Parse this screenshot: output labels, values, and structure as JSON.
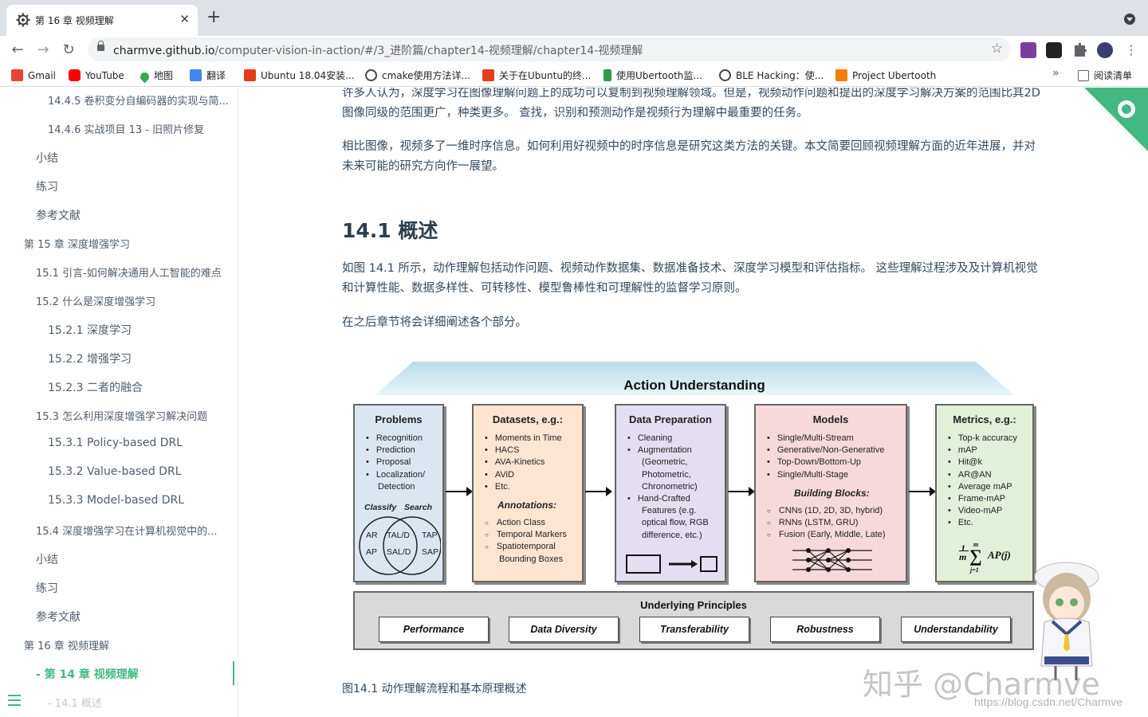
{
  "browser": {
    "tab_title": "第 16 章 视频理解",
    "tab_close": "✕",
    "new_tab": "+",
    "url_host": "charmve.github.io",
    "url_path": "/computer-vision-in-action/#/3_进阶篇/chapter14-视频理解/chapter14-视频理解",
    "back": "←",
    "forward": "→",
    "reload": "↻",
    "star": "☆",
    "bookmarks": [
      {
        "label": "Gmail",
        "icon": "gmail-icon",
        "color": "#ea4335"
      },
      {
        "label": "YouTube",
        "icon": "youtube-icon",
        "color": "#ff0000"
      },
      {
        "label": "地图",
        "icon": "maps-icon",
        "color": "#34a853"
      },
      {
        "label": "翻译",
        "icon": "translate-icon",
        "color": "#4285f4"
      },
      {
        "label": "Ubuntu 18.04安装...",
        "icon": "csdn-icon",
        "color": "#e33e1b"
      },
      {
        "label": "cmake使用方法详...",
        "icon": "zhihu-icon",
        "color": "#444444"
      },
      {
        "label": "关于在Ubuntu的终...",
        "icon": "csdn-icon",
        "color": "#e33e1b"
      },
      {
        "label": "使用Ubertooth监...",
        "icon": "bar-icon",
        "color": "#2e9b47"
      },
      {
        "label": "BLE Hacking：使...",
        "icon": "zhihu-icon",
        "color": "#444444"
      },
      {
        "label": "Project Ubertooth",
        "icon": "blogger-icon",
        "color": "#f57d00"
      }
    ],
    "more": "»",
    "reading_list": "阅读清单"
  },
  "sidebar": {
    "items": [
      {
        "label": "14.4.5 卷积变分自编码器的实现与简...",
        "level": 2,
        "small": true
      },
      {
        "label": "14.4.6 实战项目 13 - 旧照片修复",
        "level": 2,
        "small": true
      },
      {
        "label": "小结",
        "level": 1
      },
      {
        "label": "练习",
        "level": 1
      },
      {
        "label": "参考文献",
        "level": 1
      },
      {
        "label": "第 15 章 深度增强学习",
        "level": 0,
        "small": true
      },
      {
        "label": "15.1 引言-如何解决通用人工智能的难点",
        "level": 1,
        "small": true
      },
      {
        "label": "15.2 什么是深度增强学习",
        "level": 1,
        "small": true
      },
      {
        "label": "15.2.1 深度学习",
        "level": 2
      },
      {
        "label": "15.2.2 增强学习",
        "level": 2
      },
      {
        "label": "15.2.3 二者的融合",
        "level": 2
      },
      {
        "label": "15.3 怎么利用深度增强学习解决问题",
        "level": 1,
        "small": true
      },
      {
        "label": "15.3.1 Policy-based DRL",
        "level": 2
      },
      {
        "label": "15.3.2 Value-based DRL",
        "level": 2
      },
      {
        "label": "15.3.3 Model-based DRL",
        "level": 2
      },
      {
        "label": "15.4 深度增强学习在计算机视觉中的...",
        "level": 1,
        "small": true
      },
      {
        "label": "小结",
        "level": 1
      },
      {
        "label": "练习",
        "level": 1
      },
      {
        "label": "参考文献",
        "level": 1
      },
      {
        "label": "第 16 章 视频理解",
        "level": 0,
        "small": true
      },
      {
        "label": "- 第 14 章 视频理解",
        "level": 1,
        "active": true
      },
      {
        "label": "- 14.1 概述",
        "level": 2,
        "faded": true
      }
    ]
  },
  "content": {
    "intro_p1": "许多人认为，深度学习在图像理解问题上的成功可以复制到视频理解领域。但是，视频动作问题和提出的深度学习解决方案的范围比其2D图像同级的范围更广，种类更多。 查找，识别和预测动作是视频行为理解中最重要的任务。",
    "intro_p2": "相比图像，视频多了一维时序信息。如何利用好视频中的时序信息是研究这类方法的关键。本文简要回顾视频理解方面的近年进展，并对未来可能的研究方向作一展望。",
    "section_title": "14.1 概述",
    "overview_p1": "如图 14.1 所示，动作理解包括动作问题、视频动作数据集、数据准备技术、深度学习模型和评估指标。 这些理解过程涉及及计算机视觉和计算性能、数据多样性、可转移性、模型鲁棒性和可理解性的监督学习原则。",
    "overview_p2": "在之后章节将会详细阐述各个部分。",
    "caption": "图14.1 动作理解流程和基本原理概述"
  },
  "figure": {
    "title": "Action Understanding",
    "problems": {
      "title": "Problems",
      "items": [
        "Recognition",
        "Prediction",
        "Proposal",
        "Localization/",
        "Detection"
      ],
      "venn_left": "Classify",
      "venn_right": "Search",
      "venn_labels": [
        "AR",
        "AP",
        "TAL/D",
        "SAL/D",
        "TAP",
        "SAP"
      ]
    },
    "datasets": {
      "title": "Datasets, e.g.:",
      "items": [
        "Moments in Time",
        "HACS",
        "AVA-Kinetics",
        "AViD",
        "Etc."
      ],
      "sub": "Annotations:",
      "sub_items": [
        "Action Class",
        "Temporal Markers",
        "Spatiotemporal",
        "Bounding Boxes"
      ]
    },
    "preparation": {
      "title": "Data Preparation",
      "items": [
        "Cleaning",
        "Augmentation",
        "(Geometric,",
        "Photometric,",
        "Chronometric)",
        "Hand-Crafted",
        "Features (e.g.",
        "optical flow, RGB",
        "difference, etc.)"
      ]
    },
    "models": {
      "title": "Models",
      "items": [
        "Single/Multi-Stream",
        "Generative/Non-Generative",
        "Top-Down/Bottom-Up",
        "Single/Multi-Stage"
      ],
      "sub": "Building Blocks:",
      "sub_items": [
        "CNNs (1D, 2D, 3D, hybrid)",
        "RNNs (LSTM, GRU)",
        "Fusion (Early, Middle,  Late)"
      ]
    },
    "metrics": {
      "title": "Metrics, e.g.:",
      "items": [
        "Top-k accuracy",
        "mAP",
        "Hit@k",
        "AR@AN",
        "Average mAP",
        "Frame-mAP",
        "Video-mAP",
        "Etc."
      ],
      "formula_num": "1",
      "formula_den": "m",
      "formula_top": "m",
      "formula_bottom": "j=1",
      "formula_body": "AP(j)"
    },
    "principles_title": "Underlying Principles",
    "principles": [
      "Performance",
      "Data Diversity",
      "Transferability",
      "Robustness",
      "Understandability"
    ]
  },
  "watermark": "知乎 @Charmve",
  "csdn_watermark": "https://blog.csdn.net/Charmve",
  "colors": {
    "accent": "#42b983",
    "problems_bg": "#dce6f1",
    "datasets_bg": "#fde5d2",
    "preparation_bg": "#e4dff0",
    "models_bg": "#f7d9dc",
    "metrics_bg": "#e2efd9"
  }
}
